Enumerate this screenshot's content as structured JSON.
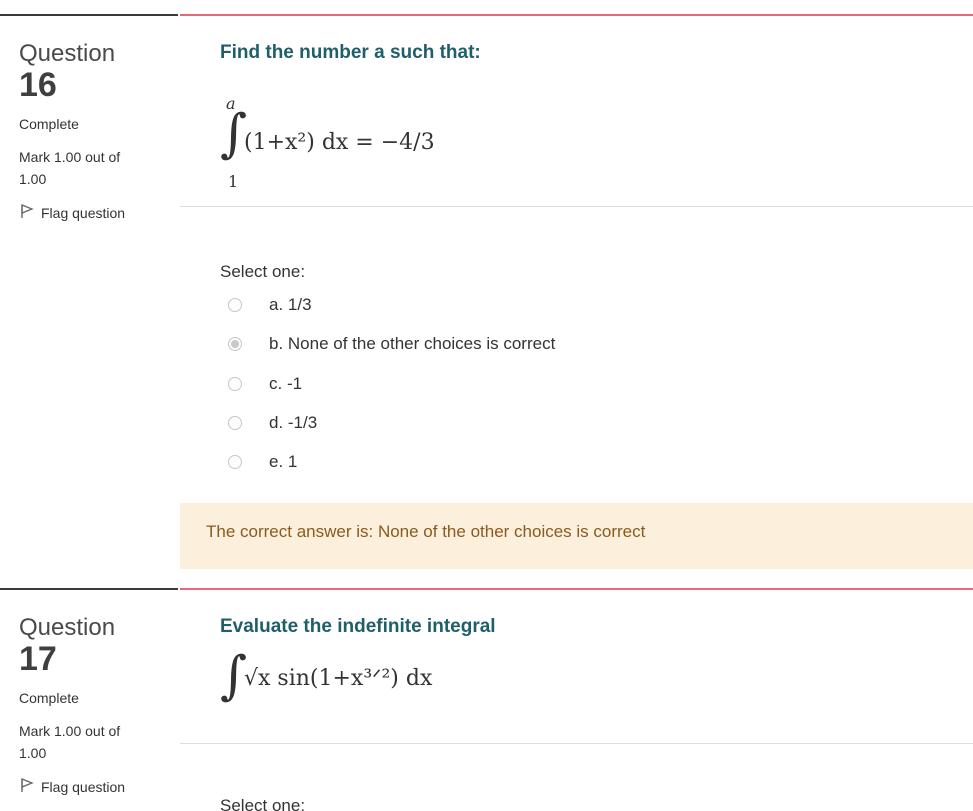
{
  "questions": [
    {
      "label": "Question",
      "number": "16",
      "state": "Complete",
      "grade": "Mark 1.00 out of 1.00",
      "flag_label": "Flag question",
      "text": "Find the number a such that:",
      "formula": {
        "upper_limit": "a",
        "lower_limit": "1",
        "integrand": "(1+x²) dx = −4/3"
      },
      "prompt": "Select one:",
      "options": [
        {
          "label": "a. 1/3",
          "selected": false
        },
        {
          "label": "b. None of the other choices is correct",
          "selected": true
        },
        {
          "label": "c. -1",
          "selected": false
        },
        {
          "label": "d. -1/3",
          "selected": false
        },
        {
          "label": "e. 1",
          "selected": false
        }
      ],
      "feedback": "The correct answer is: None of the other choices is correct"
    },
    {
      "label": "Question",
      "number": "17",
      "state": "Complete",
      "grade": "Mark 1.00 out of 1.00",
      "flag_label": "Flag question",
      "text": "Evaluate the indefinite integral",
      "formula": {
        "integrand": "√x sin(1+x³ᐟ²) dx"
      },
      "prompt": "Select one:"
    }
  ],
  "colors": {
    "question_text": "#1f5e6b",
    "content_border": "#e46a79",
    "info_border": "#3a3a3a",
    "feedback_bg": "#fcefdc",
    "feedback_text": "#8a5a1e"
  }
}
